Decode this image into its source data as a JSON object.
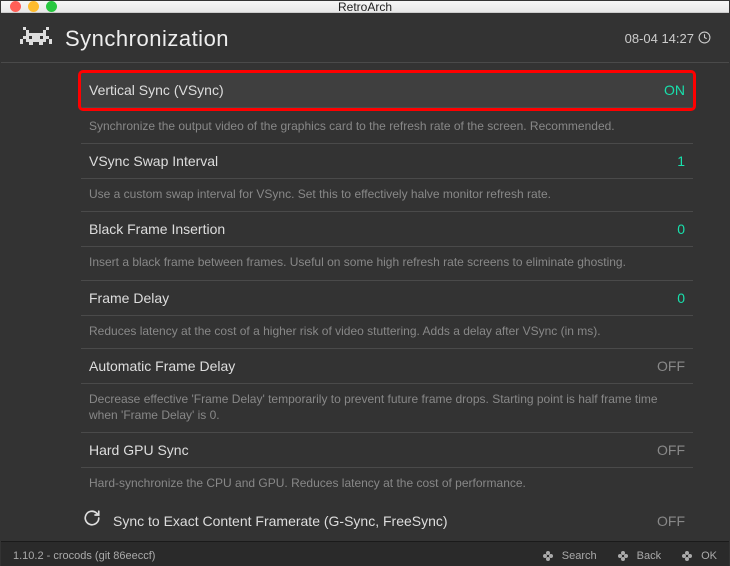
{
  "window": {
    "title": "RetroArch"
  },
  "header": {
    "title": "Synchronization",
    "datetime": "08-04 14:27"
  },
  "items": [
    {
      "label": "Vertical Sync (VSync)",
      "value": "ON",
      "value_class": "val-on",
      "selected": true,
      "desc": "Synchronize the output video of the graphics card to the refresh rate of the screen. Recommended."
    },
    {
      "label": "VSync Swap Interval",
      "value": "1",
      "value_class": "val-num",
      "desc": "Use a custom swap interval for VSync. Set this to effectively halve monitor refresh rate."
    },
    {
      "label": "Black Frame Insertion",
      "value": "0",
      "value_class": "val-num",
      "desc": "Insert a black frame between frames. Useful on some high refresh rate screens to eliminate ghosting."
    },
    {
      "label": "Frame Delay",
      "value": "0",
      "value_class": "val-num",
      "desc": "Reduces latency at the cost of a higher risk of video stuttering. Adds a delay after VSync (in ms)."
    },
    {
      "label": "Automatic Frame Delay",
      "value": "OFF",
      "value_class": "val-off",
      "desc": "Decrease effective 'Frame Delay' temporarily to prevent future frame drops. Starting point is half frame time when 'Frame Delay' is 0."
    },
    {
      "label": "Hard GPU Sync",
      "value": "OFF",
      "value_class": "val-off",
      "desc": "Hard-synchronize the CPU and GPU. Reduces latency at the cost of performance."
    },
    {
      "label": "Sync to Exact Content Framerate (G-Sync, FreeSync)",
      "value": "OFF",
      "value_class": "val-off",
      "icon": true
    }
  ],
  "footer": {
    "version": "1.10.2 - crocods (git 86eeccf)",
    "search": "Search",
    "back": "Back",
    "ok": "OK"
  }
}
